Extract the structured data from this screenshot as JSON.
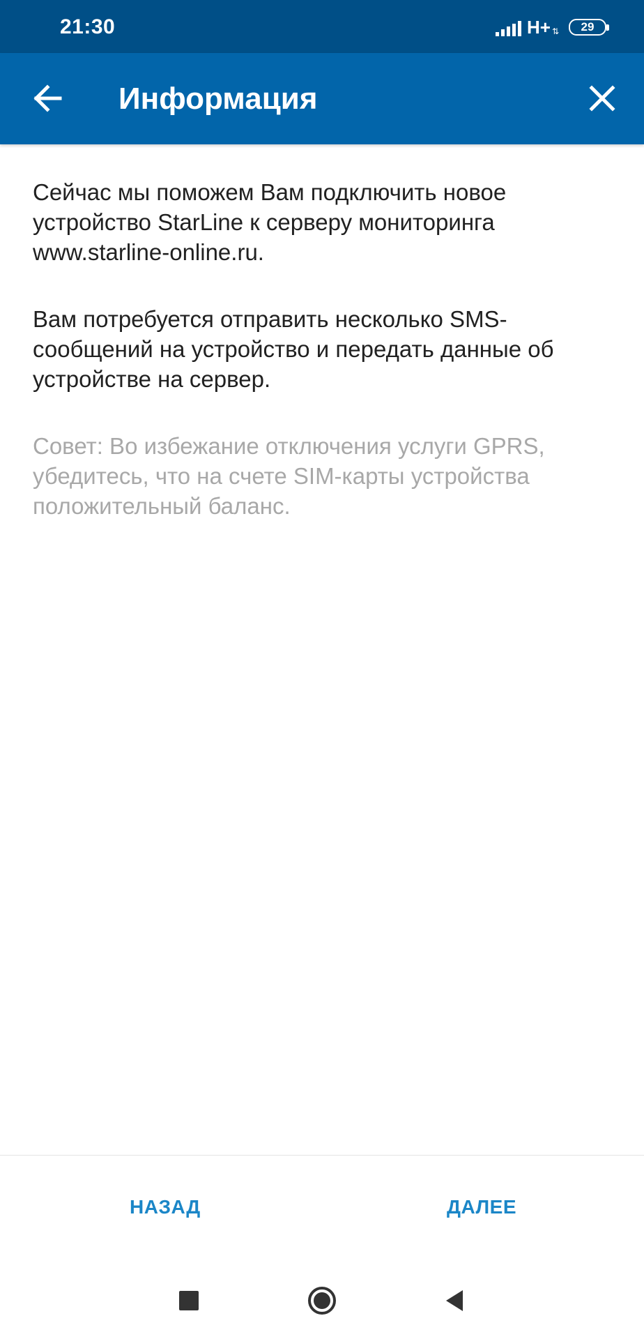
{
  "status_bar": {
    "time": "21:30",
    "network": "H+",
    "battery": "29"
  },
  "app_bar": {
    "title": "Информация",
    "back_icon": "arrow-left-icon",
    "close_icon": "close-icon"
  },
  "content": {
    "paragraphs": [
      "Сейчас мы поможем Вам подключить новое устройство StarLine к серверу мониторинга www.starline-online.ru.",
      "Вам потребуется отправить несколько SMS-сообщений на устройство и передать данные об устройстве на сервер."
    ],
    "tip": "Совет: Во избежание отключения услуги GPRS, убедитесь, что на счете SIM-карты устройства положительный баланс."
  },
  "buttons": {
    "back_label": "НАЗАД",
    "next_label": "ДАЛЕЕ"
  },
  "colors": {
    "status_bar": "#004f87",
    "app_bar": "#0265aa",
    "accent": "#1b86c7",
    "tip_text": "#a8a8a8"
  },
  "nav_bar": {
    "icons": [
      "recents-square-icon",
      "home-circle-icon",
      "back-triangle-icon"
    ]
  }
}
